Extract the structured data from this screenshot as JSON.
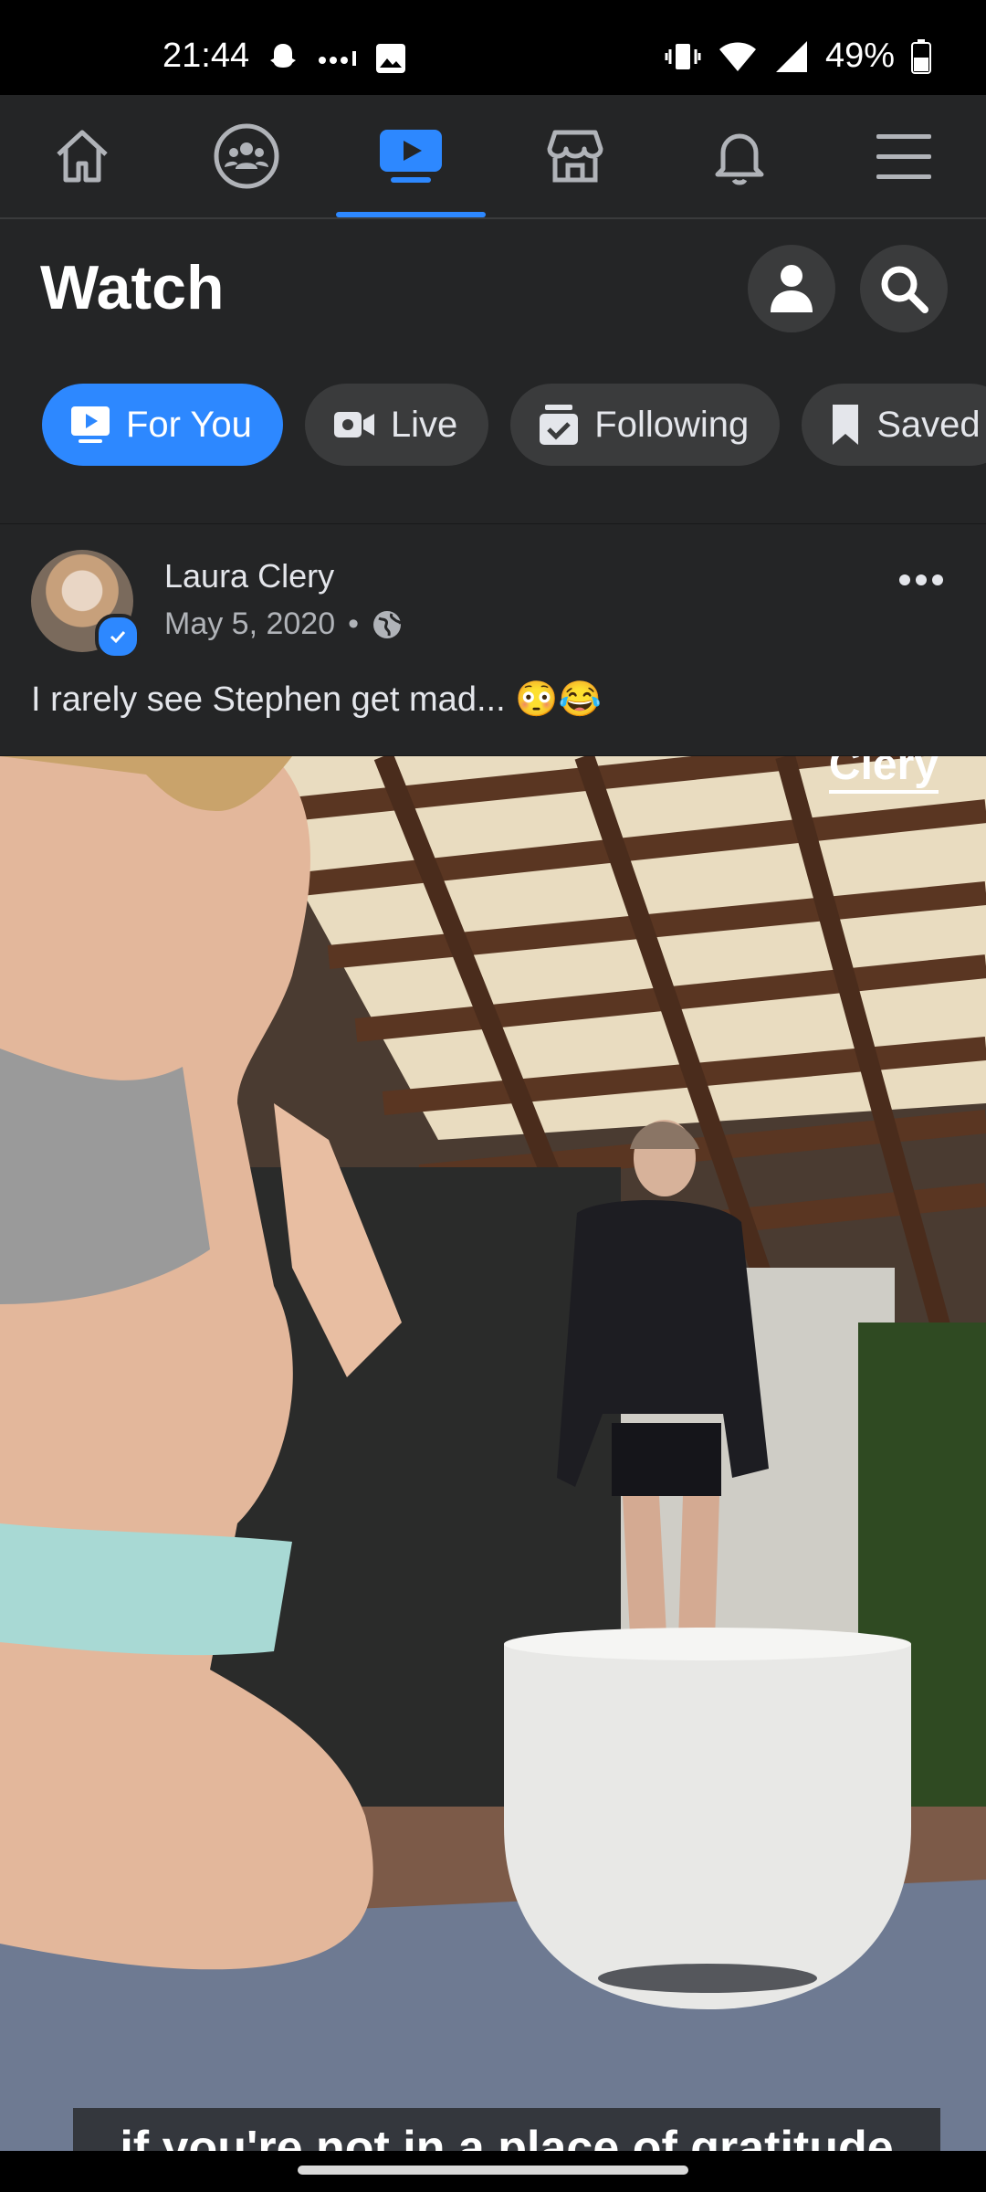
{
  "status_bar": {
    "time": "21:44",
    "battery": "49%"
  },
  "nav": {
    "items": [
      {
        "name": "home-icon"
      },
      {
        "name": "groups-icon"
      },
      {
        "name": "watch-icon",
        "active": true
      },
      {
        "name": "marketplace-icon"
      },
      {
        "name": "notifications-icon"
      },
      {
        "name": "menu-icon"
      }
    ],
    "accent": "#2d88ff"
  },
  "header": {
    "title": "Watch",
    "chips": [
      {
        "label": "For You",
        "icon": "play-icon",
        "active": true
      },
      {
        "label": "Live",
        "icon": "video-camera-icon"
      },
      {
        "label": "Following",
        "icon": "following-icon"
      },
      {
        "label": "Saved",
        "icon": "bookmark-icon"
      }
    ]
  },
  "post": {
    "author": "Laura Clery",
    "date": "May 5, 2020",
    "separator": "•",
    "caption": "I rarely see Stephen get mad... 😳😂"
  },
  "video": {
    "watermark": "Clery",
    "subtitle": "if you're not in a place of gratitude"
  }
}
